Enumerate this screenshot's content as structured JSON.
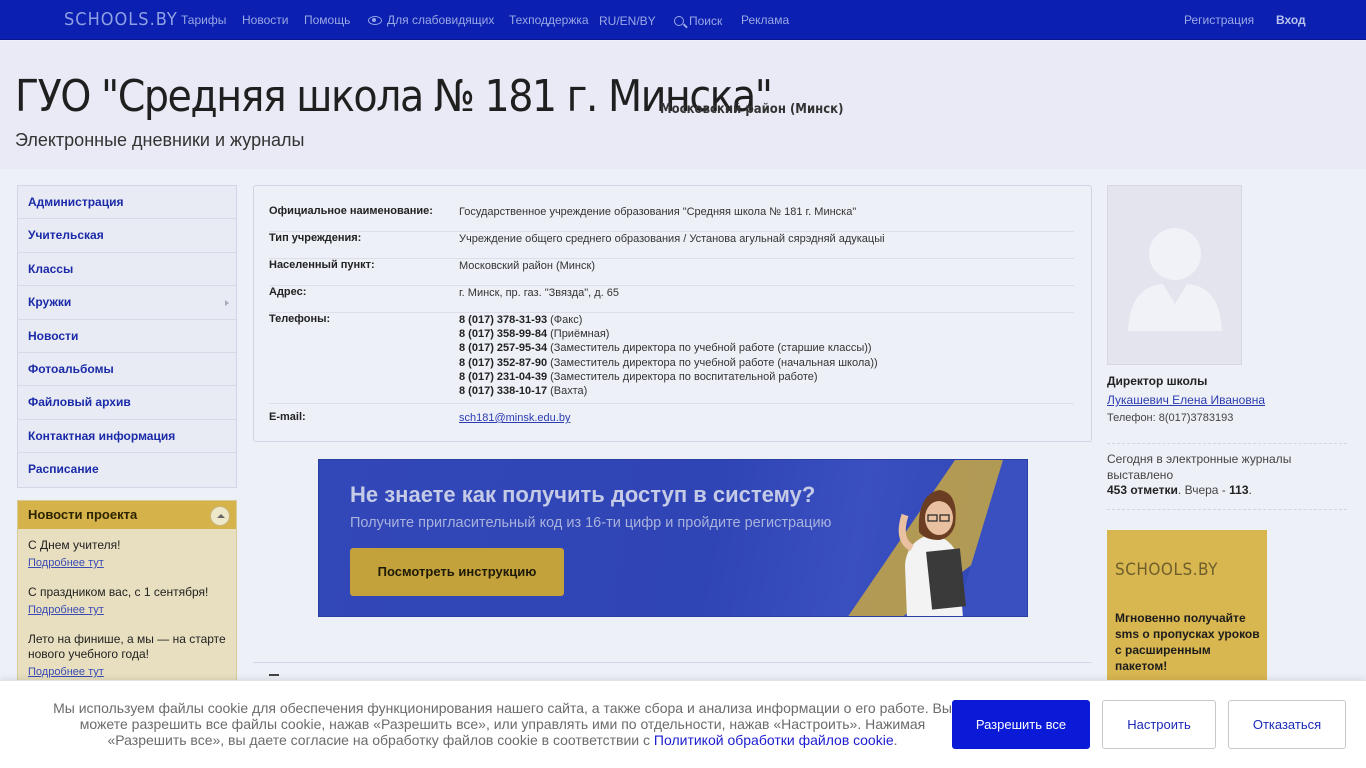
{
  "topnav": {
    "logo": "SCHOOLS.BY",
    "items": [
      "Тарифы",
      "Новости",
      "Помощь",
      "Для слабовидящих",
      "Техподдержка",
      "RU/EN/BY",
      "Поиск",
      "Реклама"
    ],
    "register": "Регистрация",
    "login": "Вход"
  },
  "header": {
    "title": "ГУО \"Средняя школа № 181 г. Минска\"",
    "district": "Московский район (Минск)",
    "subtitle": "Электронные дневники и журналы"
  },
  "sidebar": {
    "items": [
      {
        "label": "Администрация"
      },
      {
        "label": "Учительская"
      },
      {
        "label": "Классы"
      },
      {
        "label": "Кружки"
      },
      {
        "label": "Новости"
      },
      {
        "label": "Фотоальбомы"
      },
      {
        "label": "Файловый архив"
      },
      {
        "label": "Контактная информация"
      },
      {
        "label": "Расписание"
      }
    ]
  },
  "news": {
    "title": "Новости проекта",
    "entries": [
      {
        "text": "С Днем учителя!",
        "link": "Подробнее тут"
      },
      {
        "text": "С праздником вас, с 1 сентября!",
        "link": "Подробнее тут"
      },
      {
        "text": "Лето на финише, а мы — на старте нового учебного года!",
        "link": "Подробнее тут"
      }
    ]
  },
  "info": {
    "rows": [
      {
        "label": "Официальное наименование:",
        "value": "Государственное учреждение образования \"Средняя школа № 181 г. Минска\""
      },
      {
        "label": "Тип учреждения:",
        "value": "Учреждение общего среднего образования / Установа агульнай сярэдняй адукацыі"
      },
      {
        "label": "Населенный пункт:",
        "value": "Московский район (Минск)"
      },
      {
        "label": "Адрес:",
        "value": "г. Минск, пр. газ. \"Звязда\", д. 65"
      }
    ],
    "phones_label": "Телефоны:",
    "phones": [
      {
        "number": "8 (017) 378-31-93",
        "note": "(Факс)"
      },
      {
        "number": "8 (017) 358-99-84",
        "note": "(Приёмная)"
      },
      {
        "number": "8 (017) 257-95-34",
        "note": "(Заместитель директора по учебной работе (старшие классы))"
      },
      {
        "number": "8 (017) 352-87-90",
        "note": "(Заместитель директора по учебной работе (начальная школа))"
      },
      {
        "number": "8 (017) 231-04-39",
        "note": "(Заместитель директора по воспитательной работе)"
      },
      {
        "number": "8 (017) 338-10-17",
        "note": "(Вахта)"
      }
    ],
    "email_label": "E-mail:",
    "email": "sch181@minsk.edu.by"
  },
  "banner": {
    "title": "Не знаете как получить доступ в систему?",
    "subtitle": "Получите пригласительный код из 16-ти цифр и пройдите регистрацию",
    "button": "Посмотреть инструкцию"
  },
  "director": {
    "role": "Директор школы",
    "name": "Лукашевич Елена Ивановна",
    "phone": "Телефон: 8(017)3783193"
  },
  "stats": {
    "text": "Сегодня в электронные журналы выставлено",
    "today": "453 отметки",
    "yesterday_label": ". Вчера - ",
    "yesterday": "113",
    "end": "."
  },
  "ad": {
    "logo": "SCHOOLS.BY",
    "text": "Мгновенно получайте sms о пропусках уроков с расширенным пакетом!"
  },
  "cookie": {
    "text_1": "Мы используем файлы cookie для обеспечения функционирования нашего сайта, а также сбора и анализа информации о его работе. Вы можете разрешить все файлы cookie, нажав «Разрешить все», или управлять ими по отдельности, нажав «Настроить». Нажимая «Разрешить все», вы даете согласие на обработку файлов cookie в соответствии с",
    "link": "Политикой обработки файлов cookie",
    "text_2": ".",
    "allow": "Разрешить все",
    "configure": "Настроить",
    "refuse": "Отказаться"
  }
}
